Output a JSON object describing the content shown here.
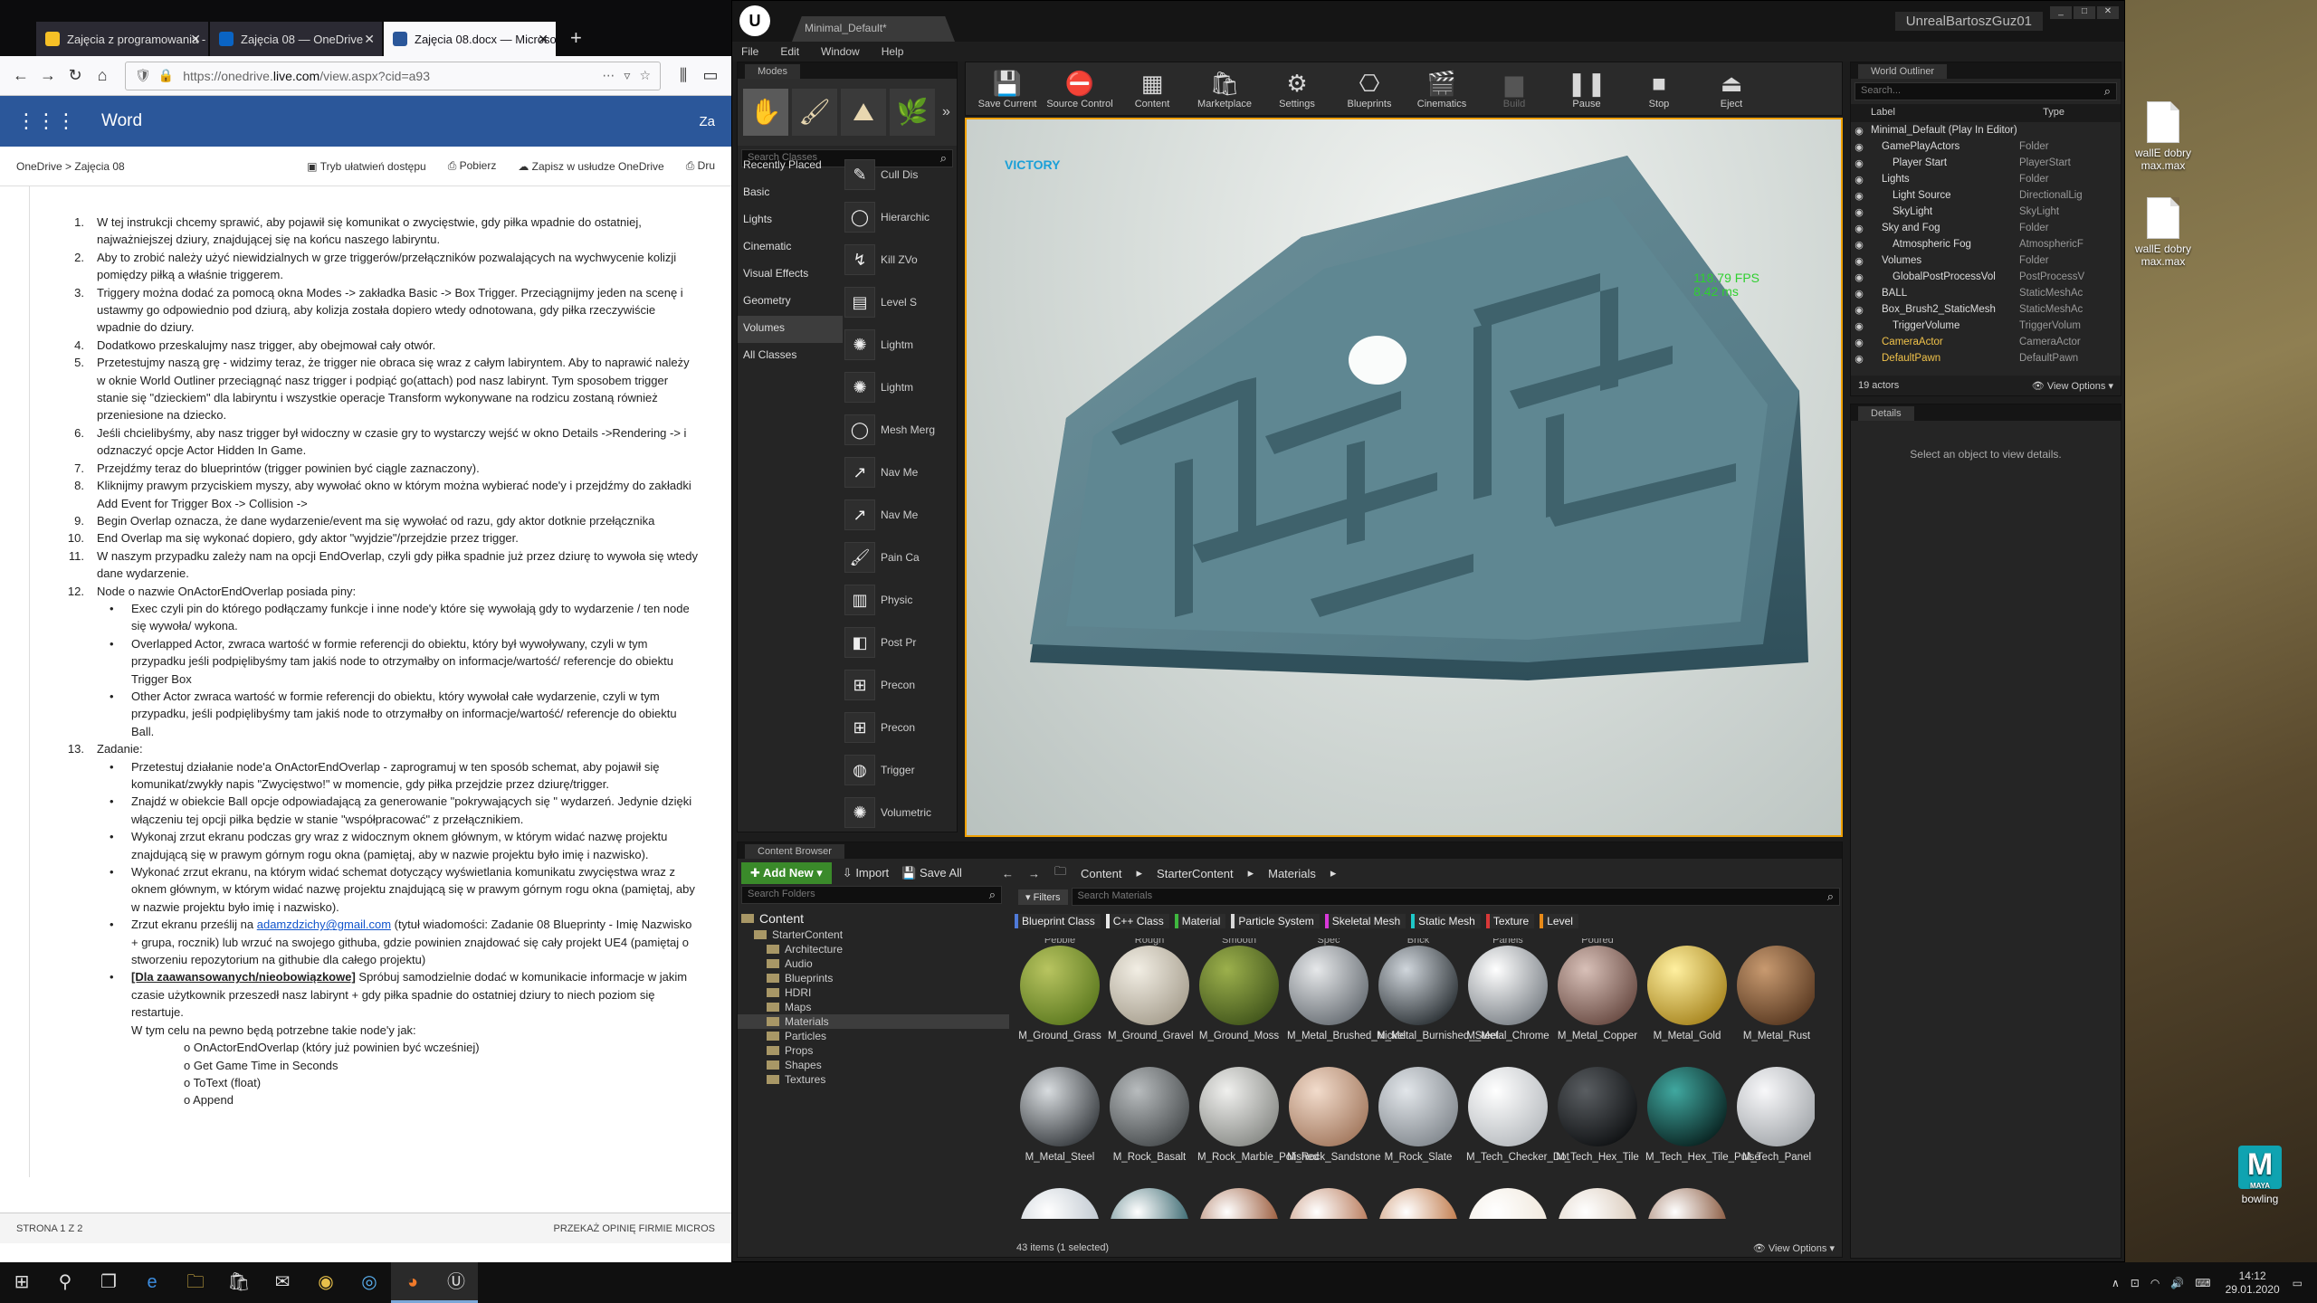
{
  "firefox": {
    "tabs": [
      {
        "label": "Zajęcia z programowania -",
        "color": "#f6c026"
      },
      {
        "label": "Zajęcia 08 — OneDrive",
        "color": "#0a64c4"
      },
      {
        "label": "Zajęcia 08.docx — Microsof",
        "color": "#2b579a"
      }
    ],
    "url_prefix": "https://onedrive.",
    "url_domain": "live.com",
    "url_rest": "/view.aspx?cid=a93",
    "app_name": "Word",
    "app_right": "Za",
    "breadcrumb": "OneDrive  >  Zajęcia 08",
    "cmds": [
      "Tryb ułatwień dostępu",
      "Pobierz",
      "Zapisz w usłudze OneDrive",
      "Dru"
    ],
    "status_left": "STRONA 1 Z 2",
    "status_right": "PRZEKAŻ OPINIĘ FIRMIE MICROS"
  },
  "doc": {
    "items": [
      {
        "n": "1.",
        "t": "W tej instrukcji chcemy sprawić, aby pojawił się komunikat o zwycięstwie, gdy piłka wpadnie do ostatniej, najważniejszej dziury, znajdującej się na końcu naszego labiryntu."
      },
      {
        "n": "2.",
        "t": "Aby to zrobić należy użyć niewidzialnych w grze triggerów/przełączników pozwalających na wychwycenie kolizji pomiędzy piłką a właśnie triggerem."
      },
      {
        "n": "3.",
        "t": "Triggery można dodać za pomocą okna Modes -> zakładka Basic -> Box Trigger. Przeciągnijmy jeden na scenę i ustawmy go odpowiednio pod dziurą, aby kolizja została dopiero wtedy odnotowana, gdy piłka rzeczywiście wpadnie do dziury."
      },
      {
        "n": "4.",
        "t": "Dodatkowo przeskalujmy nasz trigger, aby obejmował cały otwór."
      },
      {
        "n": "5.",
        "t": "Przetestujmy naszą grę - widzimy teraz, że trigger nie obraca się wraz z całym labiryntem. Aby to naprawić należy w oknie World Outliner przeciągnąć nasz trigger i podpiąć go(attach) pod nasz labirynt. Tym sposobem trigger stanie się \"dzieckiem\" dla labiryntu i wszystkie operacje Transform wykonywane na rodzicu zostaną również przeniesione na dziecko."
      },
      {
        "n": "6.",
        "t": "Jeśli chcielibyśmy, aby nasz trigger był widoczny w czasie gry to wystarczy wejść w okno Details ->Rendering -> i odznaczyć opcje Actor Hidden In Game."
      },
      {
        "n": "7.",
        "t": "Przejdźmy teraz do blueprintów (trigger powinien być ciągle zaznaczony)."
      },
      {
        "n": "8.",
        "t": "Kliknijmy prawym przyciskiem myszy, aby wywołać okno w którym można wybierać node'y i przejdźmy do zakładki Add Event for Trigger Box -> Collision ->"
      },
      {
        "n": "9.",
        "t": "Begin Overlap oznacza, że dane wydarzenie/event ma się wywołać od razu, gdy aktor dotknie przełącznika"
      },
      {
        "n": "10.",
        "t": "End Overlap ma się wykonać dopiero, gdy aktor \"wyjdzie\"/przejdzie przez trigger."
      },
      {
        "n": "11.",
        "t": "W naszym przypadku zależy nam na opcji EndOverlap, czyli gdy piłka spadnie już przez dziurę to wywoła się wtedy dane wydarzenie."
      },
      {
        "n": "12.",
        "t": "Node o nazwie OnActorEndOverlap posiada piny:"
      }
    ],
    "sub12": [
      "Exec czyli pin do którego podłączamy funkcje i inne node'y które się wywołają gdy to wydarzenie / ten node się wywoła/ wykona.",
      "Overlapped Actor, zwraca wartość w formie referencji do obiektu, który był wywoływany, czyli w tym przypadku jeśli podpięlibyśmy tam jakiś node to otrzymałby on informacje/wartość/ referencje do obiektu Trigger Box",
      "Other Actor zwraca wartość w formie referencji do obiektu, który wywołał całe wydarzenie, czyli w tym przypadku, jeśli podpięlibyśmy tam jakiś node to otrzymałby on informacje/wartość/ referencje do obiektu Ball."
    ],
    "item13": {
      "n": "13.",
      "t": "Zadanie:"
    },
    "sub13": [
      "Przetestuj działanie node'a OnActorEndOverlap - zaprogramuj w ten sposób schemat, aby pojawił się komunikat/zwykły napis \"Zwycięstwo!\" w momencie, gdy piłka przejdzie przez dziurę/trigger.",
      "Znajdź w obiekcie Ball opcje odpowiadającą za generowanie \"pokrywających się \" wydarzeń. Jedynie dzięki włączeniu tej opcji piłka będzie w stanie \"współpracować\" z przełącznikiem.",
      "Wykonaj zrzut ekranu podczas gry wraz z widocznym oknem głównym, w którym widać nazwę projektu znajdującą się w prawym górnym rogu okna (pamiętaj, aby w nazwie projektu było imię i nazwisko).",
      "Wykonać zrzut ekranu, na którym widać schemat dotyczący wyświetlania komunikatu zwycięstwa wraz z oknem głównym, w którym widać nazwę projektu znajdującą się w prawym górnym rogu okna (pamiętaj, aby w nazwie projektu było imię i nazwisko)."
    ],
    "email_pre": "Zrzut ekranu prześlij na ",
    "email": "adamzdzichy@gmail.com",
    "email_post": " (tytuł wiadomości: Zadanie 08 Blueprinty - Imię Nazwisko + grupa, rocznik) lub wrzuć na swojego githuba, gdzie powinien znajdować się cały projekt UE4 (pamiętaj o stworzeniu repozytorium na githubie dla całego projektu)",
    "adv_bold": "[Dla zaawansowanych/nieobowiązkowe]",
    "adv_rest": " Spróbuj samodzielnie dodać w komunikacie informacje w jakim czasie użytkownik przeszedł nasz labirynt + gdy piłka spadnie do ostatniej dziury to niech poziom się restartuje.",
    "needed": "W tym celu na pewno będą potrzebne takie node'y jak:",
    "nodes": [
      "o OnActorEndOverlap (który już powinien być wcześniej)",
      "o Get Game Time in Seconds",
      "o ToText (float)",
      "o Append"
    ]
  },
  "unreal": {
    "project_tab": "Minimal_Default*",
    "project_name": "UnrealBartoszGuz01",
    "menu": [
      "File",
      "Edit",
      "Window",
      "Help"
    ],
    "modes": {
      "title": "Modes",
      "search_placeholder": "Search Classes",
      "categories": [
        "Recently Placed",
        "Basic",
        "Lights",
        "Cinematic",
        "Visual Effects",
        "Geometry",
        "Volumes",
        "All Classes"
      ],
      "places": [
        "Cull Dis",
        "Hierarchic",
        "Kill ZVo",
        "Level S",
        "Lightm",
        "Lightm",
        "Mesh Merg",
        "Nav Me",
        "Nav Me",
        "Pain Ca",
        "Physic",
        "Post Pr",
        "Precon",
        "Precon",
        "Trigger",
        "Volumetric"
      ]
    },
    "toolbar": [
      {
        "label": "Save Current",
        "icon": "💾"
      },
      {
        "label": "Source Control",
        "icon": "⛔"
      },
      {
        "label": "Content",
        "icon": "▦"
      },
      {
        "label": "Marketplace",
        "icon": "🛍"
      },
      {
        "label": "Settings",
        "icon": "⚙"
      },
      {
        "label": "Blueprints",
        "icon": "⎔"
      },
      {
        "label": "Cinematics",
        "icon": "🎬"
      },
      {
        "label": "Build",
        "icon": "▆",
        "dim": true
      },
      {
        "label": "Pause",
        "icon": "❚❚"
      },
      {
        "label": "Stop",
        "icon": "■"
      },
      {
        "label": "Eject",
        "icon": "⏏"
      }
    ],
    "viewport": {
      "victory": "VICTORY",
      "fps": "118.79 FPS",
      "ms": "8.42 ms"
    },
    "outliner": {
      "title": "World Outliner",
      "search_placeholder": "Search...",
      "col_label": "Label",
      "col_type": "Type",
      "rows": [
        {
          "indent": 0,
          "name": "Minimal_Default (Play In Editor)",
          "type": ""
        },
        {
          "indent": 1,
          "name": "GamePlayActors",
          "type": "Folder"
        },
        {
          "indent": 2,
          "name": "Player Start",
          "type": "PlayerStart"
        },
        {
          "indent": 1,
          "name": "Lights",
          "type": "Folder"
        },
        {
          "indent": 2,
          "name": "Light Source",
          "type": "DirectionalLig"
        },
        {
          "indent": 2,
          "name": "SkyLight",
          "type": "SkyLight"
        },
        {
          "indent": 1,
          "name": "Sky and Fog",
          "type": "Folder"
        },
        {
          "indent": 2,
          "name": "Atmospheric Fog",
          "type": "AtmosphericF"
        },
        {
          "indent": 1,
          "name": "Volumes",
          "type": "Folder"
        },
        {
          "indent": 2,
          "name": "GlobalPostProcessVol",
          "type": "PostProcessV"
        },
        {
          "indent": 1,
          "name": "BALL",
          "type": "StaticMeshAc"
        },
        {
          "indent": 1,
          "name": "Box_Brush2_StaticMesh",
          "type": "StaticMeshAc"
        },
        {
          "indent": 2,
          "name": "TriggerVolume",
          "type": "TriggerVolum"
        },
        {
          "indent": 1,
          "name": "CameraActor",
          "type": "CameraActor",
          "style": "yel"
        },
        {
          "indent": 1,
          "name": "DefaultPawn",
          "type": "DefaultPawn",
          "style": "yel"
        }
      ],
      "count": "19 actors",
      "view_options": "View Options"
    },
    "details": {
      "title": "Details",
      "msg": "Select an object to view details."
    },
    "content_browser": {
      "title": "Content Browser",
      "add_new": "Add New",
      "import": "Import",
      "save_all": "Save All",
      "path": [
        "Content",
        "StarterContent",
        "Materials"
      ],
      "folder_search": "Search Folders",
      "filters": "Filters",
      "asset_search": "Search Materials",
      "tree": [
        {
          "indent": 0,
          "name": "Content",
          "top": true
        },
        {
          "indent": 1,
          "name": "StarterContent"
        },
        {
          "indent": 2,
          "name": "Architecture"
        },
        {
          "indent": 2,
          "name": "Audio"
        },
        {
          "indent": 2,
          "name": "Blueprints"
        },
        {
          "indent": 2,
          "name": "HDRI"
        },
        {
          "indent": 2,
          "name": "Maps"
        },
        {
          "indent": 2,
          "name": "Materials",
          "sel": true
        },
        {
          "indent": 2,
          "name": "Particles"
        },
        {
          "indent": 2,
          "name": "Props"
        },
        {
          "indent": 2,
          "name": "Shapes"
        },
        {
          "indent": 2,
          "name": "Textures"
        }
      ],
      "chips": [
        {
          "label": "Blueprint Class",
          "color": "#4f7ad8"
        },
        {
          "label": "C++ Class",
          "color": "#e8e8e8"
        },
        {
          "label": "Material",
          "color": "#3fb73f"
        },
        {
          "label": "Particle System",
          "color": "#d8d8d8"
        },
        {
          "label": "Skeletal Mesh",
          "color": "#d838d8"
        },
        {
          "label": "Static Mesh",
          "color": "#1fc8c8"
        },
        {
          "label": "Texture",
          "color": "#d83838"
        },
        {
          "label": "Level",
          "color": "#e88a18"
        }
      ],
      "partial_row": [
        "Pebble",
        "Rough",
        "Smooth",
        "Spec",
        "Brick",
        "Panels",
        "Poured"
      ],
      "assets_row1": [
        {
          "name": "M_Ground_Grass",
          "c1": "#b8c460",
          "c2": "#5d7a20"
        },
        {
          "name": "M_Ground_Gravel",
          "c1": "#f2eee4",
          "c2": "#a8a090"
        },
        {
          "name": "M_Ground_Moss",
          "c1": "#9cb04c",
          "c2": "#42561c"
        },
        {
          "name": "M_Metal_Brushed_Nickel",
          "c1": "#e6e8ea",
          "c2": "#6a7076"
        },
        {
          "name": "M_Metal_Burnished_Steel",
          "c1": "#d0d6dc",
          "c2": "#2e3438"
        },
        {
          "name": "M_Metal_Chrome",
          "c1": "#ffffff",
          "c2": "#7c8288"
        },
        {
          "name": "M_Metal_Copper",
          "c1": "#d8c0b8",
          "c2": "#6a4c44"
        },
        {
          "name": "M_Metal_Gold",
          "c1": "#fff0a0",
          "c2": "#a88620"
        },
        {
          "name": "M_Metal_Rust",
          "c1": "#c89a70",
          "c2": "#5a3a22"
        }
      ],
      "assets_row2": [
        {
          "name": "M_Metal_Steel",
          "c1": "#d8dcdf",
          "c2": "#3a3e42"
        },
        {
          "name": "M_Rock_Basalt",
          "c1": "#b8bcbe",
          "c2": "#4a4e50"
        },
        {
          "name": "M_Rock_Marble_Polished",
          "c1": "#f0f0ee",
          "c2": "#8a8c88"
        },
        {
          "name": "M_Rock_Sandstone",
          "c1": "#f2dccc",
          "c2": "#a47a60"
        },
        {
          "name": "M_Rock_Slate",
          "c1": "#e2e6ea",
          "c2": "#848a90"
        },
        {
          "name": "M_Tech_Checker_Dot",
          "c1": "#ffffff",
          "c2": "#b8bcc0"
        },
        {
          "name": "M_Tech_Hex_Tile",
          "c1": "#5a5e62",
          "c2": "#101214"
        },
        {
          "name": "M_Tech_Hex_Tile_Pulse",
          "c1": "#40a8a0",
          "c2": "#0a2422"
        },
        {
          "name": "M_Tech_Panel",
          "c1": "#f8f8fa",
          "c2": "#a4a8ac"
        }
      ],
      "assets_row3_colors": [
        "#c0c8d0",
        "#3a6870",
        "#9a5a3a",
        "#b87a5a",
        "#c07a4a",
        "#f0e8dc",
        "#d8c8b8",
        "#8a5a40"
      ],
      "count": "43 items (1 selected)",
      "view_options": "View Options"
    }
  },
  "desktop": {
    "icons": [
      "wallE dobry max.max",
      "wallE dobry max.max",
      "bowling"
    ]
  },
  "taskbar": {
    "time": "14:12",
    "date": "29.01.2020"
  }
}
